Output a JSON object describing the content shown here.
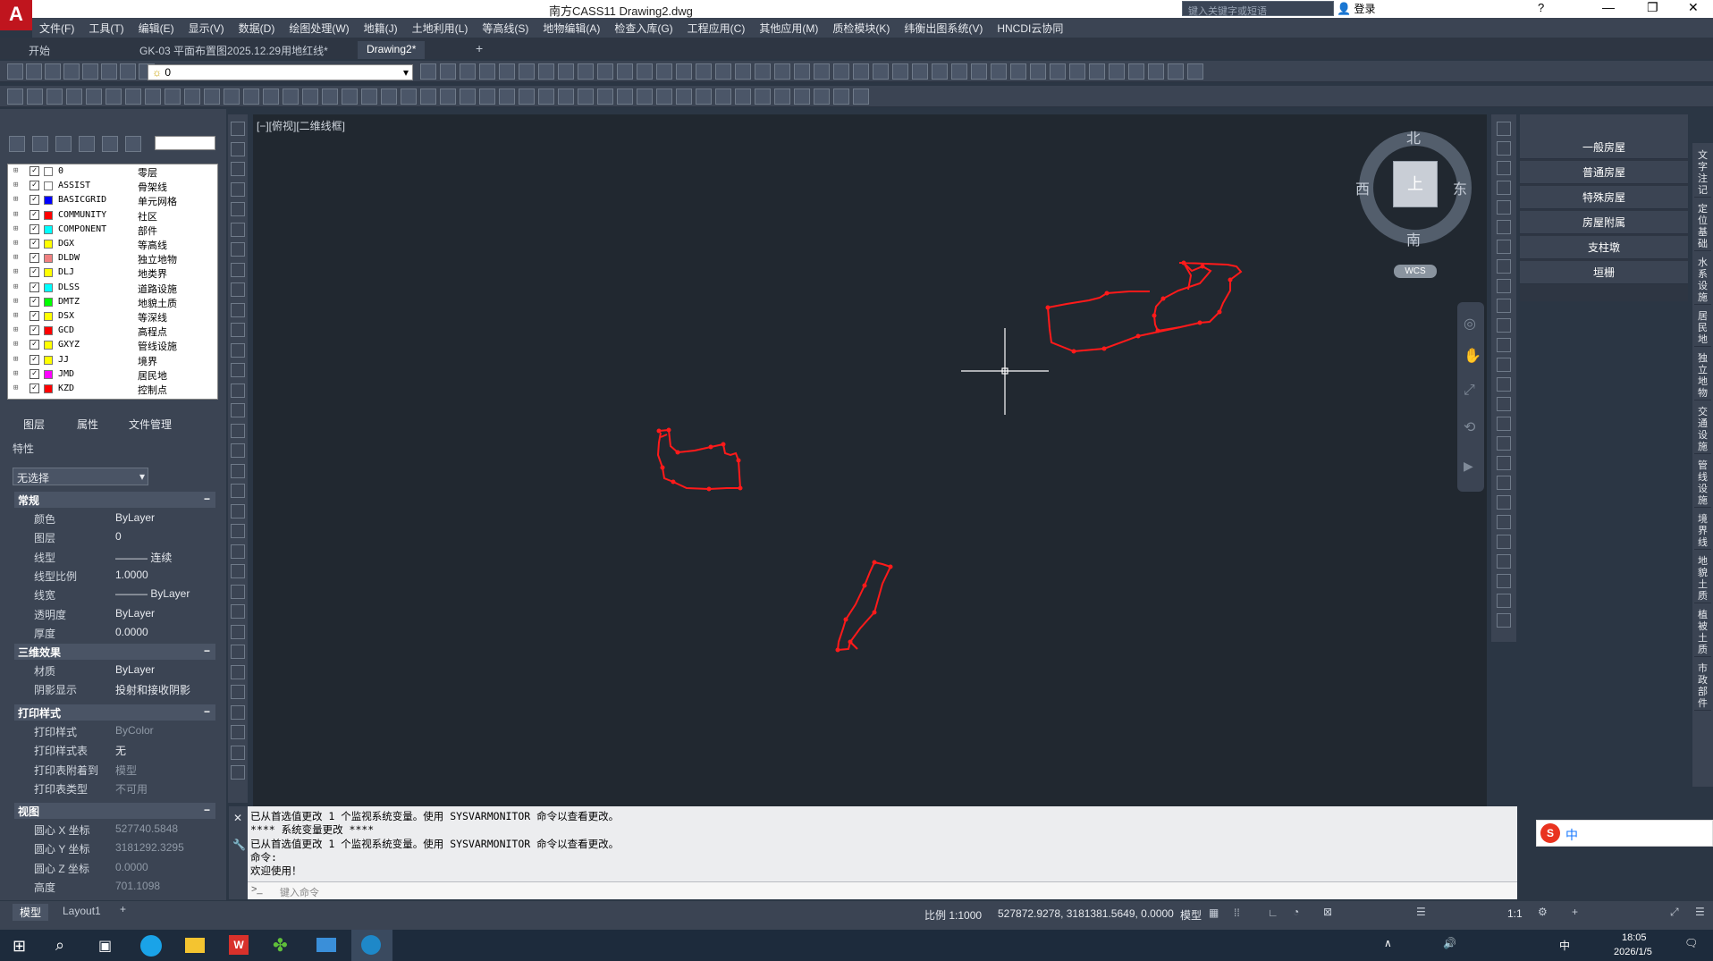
{
  "window": {
    "title": "南方CASS11     Drawing2.dwg",
    "search_placeholder": "键入关键字或短语",
    "login_label": "登录"
  },
  "menu": [
    "文件(F)",
    "工具(T)",
    "编辑(E)",
    "显示(V)",
    "数据(D)",
    "绘图处理(W)",
    "地籍(J)",
    "土地利用(L)",
    "等高线(S)",
    "地物编辑(A)",
    "检查入库(G)",
    "工程应用(C)",
    "其他应用(M)",
    "质检模块(K)",
    "纬衡出图系统(V)",
    "HNCDI云协同"
  ],
  "doc_tabs": [
    {
      "label": "开始"
    },
    {
      "label": "GK-03 平面布置图2025.12.29用地红线*"
    },
    {
      "label": "Drawing2*"
    }
  ],
  "layer_combo_value": "0",
  "layers": [
    {
      "name": "0",
      "desc": "零层",
      "color": "#ffffff"
    },
    {
      "name": "ASSIST",
      "desc": "骨架线",
      "color": "#ffffff"
    },
    {
      "name": "BASICGRID",
      "desc": "单元网格",
      "color": "#0000ff"
    },
    {
      "name": "COMMUNITY",
      "desc": "社区",
      "color": "#ff0000"
    },
    {
      "name": "COMPONENT",
      "desc": "部件",
      "color": "#00ffff"
    },
    {
      "name": "DGX",
      "desc": "等高线",
      "color": "#ffff00"
    },
    {
      "name": "DLDW",
      "desc": "独立地物",
      "color": "#f08080"
    },
    {
      "name": "DLJ",
      "desc": "地类界",
      "color": "#ffff00"
    },
    {
      "name": "DLSS",
      "desc": "道路设施",
      "color": "#00ffff"
    },
    {
      "name": "DMTZ",
      "desc": "地貌土质",
      "color": "#00ff00"
    },
    {
      "name": "DSX",
      "desc": "等深线",
      "color": "#ffff00"
    },
    {
      "name": "GCD",
      "desc": "高程点",
      "color": "#ff0000"
    },
    {
      "name": "GXYZ",
      "desc": "管线设施",
      "color": "#ffff00"
    },
    {
      "name": "JJ",
      "desc": "境界",
      "color": "#ffff00"
    },
    {
      "name": "JMD",
      "desc": "居民地",
      "color": "#ff00ff"
    },
    {
      "name": "KZD",
      "desc": "控制点",
      "color": "#ff0000"
    }
  ],
  "panel_tabs": {
    "layers": "图层",
    "properties": "属性",
    "files": "文件管理"
  },
  "props": {
    "header": "特性",
    "selection": "无选择",
    "general": {
      "title": "常规",
      "rows": [
        {
          "k": "颜色",
          "v": "ByLayer"
        },
        {
          "k": "图层",
          "v": "0"
        },
        {
          "k": "线型",
          "v": "——— 连续"
        },
        {
          "k": "线型比例",
          "v": "1.0000"
        },
        {
          "k": "线宽",
          "v": "——— ByLayer"
        },
        {
          "k": "透明度",
          "v": "ByLayer"
        },
        {
          "k": "厚度",
          "v": "0.0000"
        }
      ]
    },
    "three_d": {
      "title": "三维效果",
      "rows": [
        {
          "k": "材质",
          "v": "ByLayer"
        },
        {
          "k": "阴影显示",
          "v": "投射和接收阴影"
        }
      ]
    },
    "plot": {
      "title": "打印样式",
      "rows": [
        {
          "k": "打印样式",
          "v": "ByColor"
        },
        {
          "k": "打印样式表",
          "v": "无"
        },
        {
          "k": "打印表附着到",
          "v": "模型"
        },
        {
          "k": "打印表类型",
          "v": "不可用"
        }
      ]
    },
    "view": {
      "title": "视图",
      "rows": [
        {
          "k": "圆心 X 坐标",
          "v": "527740.5848"
        },
        {
          "k": "圆心 Y 坐标",
          "v": "3181292.3295"
        },
        {
          "k": "圆心 Z 坐标",
          "v": "0.0000"
        },
        {
          "k": "高度",
          "v": "701.1098"
        }
      ]
    }
  },
  "viewport": {
    "label": "[−][俯视][二维线框]",
    "compass": {
      "n": "北",
      "s": "南",
      "e": "东",
      "w": "西",
      "top": "上"
    },
    "wcs": "WCS"
  },
  "command": {
    "lines": [
      "已从首选值更改 1 个监视系统变量。使用 SYSVARMONITOR 命令以查看更改。",
      "**** 系统变量更改 ****",
      "已从首选值更改 1 个监视系统变量。使用 SYSVARMONITOR 命令以查看更改。",
      "命令:",
      "欢迎使用！"
    ],
    "placeholder": "键入命令"
  },
  "right_palette": [
    "一般房屋",
    "普通房屋",
    "特殊房屋",
    "房屋附属",
    "支柱墩",
    "垣栅"
  ],
  "side_tabs": [
    "文字注记",
    "定位基础",
    "水系设施",
    "居民地",
    "独立地物",
    "交通设施",
    "管线设施",
    "境界线",
    "地貌土质",
    "植被土质",
    "市政部件"
  ],
  "layout_tabs": {
    "model": "模型",
    "layout1": "Layout1"
  },
  "status": {
    "scale": "比例 1:1000",
    "coords": "527872.9278, 3181381.5649, 0.0000",
    "model": "模型",
    "anno_scale": "1:1"
  },
  "taskbar": {
    "time": "18:05",
    "date": "2026/1/5",
    "ime": "中"
  },
  "colors": {
    "accent": "#c0151e",
    "drawing": "#ff1a1a",
    "viewport_bg": "#212830"
  }
}
